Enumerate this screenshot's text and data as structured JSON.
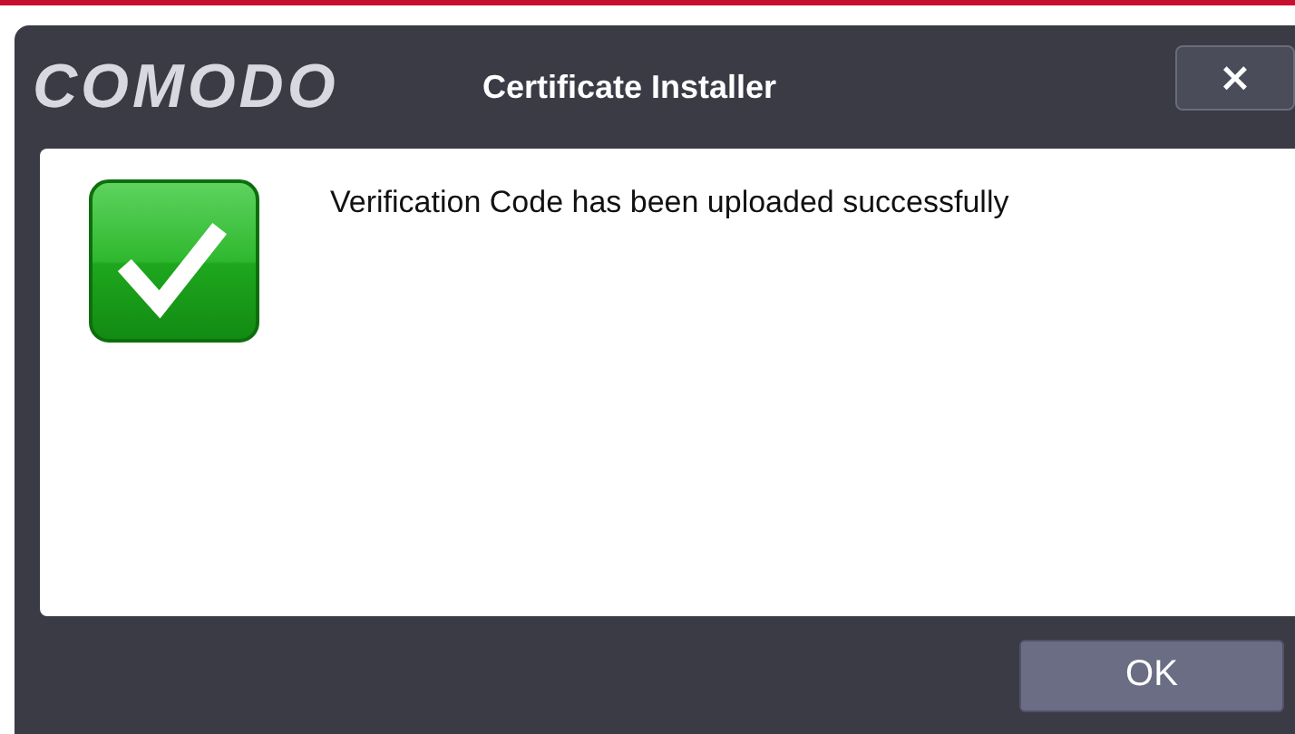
{
  "window": {
    "logo": "COMODO",
    "title": "Certificate Installer",
    "close": "×"
  },
  "message": "Verification Code has been uploaded successfully",
  "buttons": [
    "OK"
  ]
}
